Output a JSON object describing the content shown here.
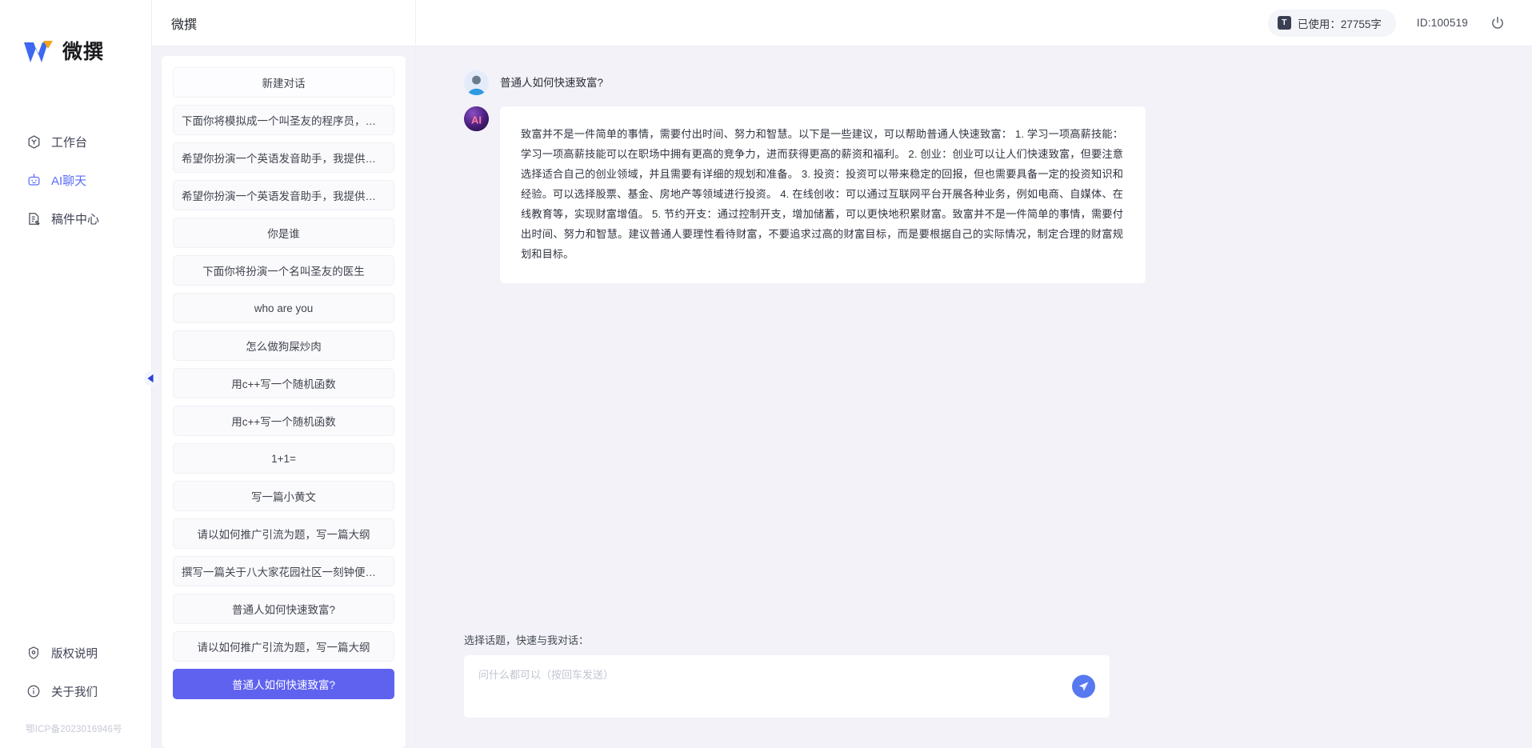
{
  "brand": {
    "logo_text": "微撰",
    "icp": "鄂ICP备2023016946号"
  },
  "nav": {
    "items": [
      {
        "label": "工作台",
        "icon": "workbench-icon",
        "active": false
      },
      {
        "label": "AI聊天",
        "icon": "robot-icon",
        "active": true
      },
      {
        "label": "稿件中心",
        "icon": "document-edit-icon",
        "active": false
      }
    ],
    "bottom_items": [
      {
        "label": "版权说明",
        "icon": "shield-icon"
      },
      {
        "label": "关于我们",
        "icon": "info-icon"
      }
    ]
  },
  "mid_header": {
    "title": "微撰"
  },
  "conversations": {
    "new_chat_label": "新建对话",
    "items": [
      {
        "label": "下面你将模拟成一个叫圣友的程序员，我说...",
        "active": false
      },
      {
        "label": "希望你扮演一个英语发音助手，我提供给你...",
        "active": false
      },
      {
        "label": "希望你扮演一个英语发音助手，我提供给你...",
        "active": false
      },
      {
        "label": "你是谁",
        "active": false
      },
      {
        "label": "下面你将扮演一个名叫圣友的医生",
        "active": false
      },
      {
        "label": "who are you",
        "active": false
      },
      {
        "label": "怎么做狗屎炒肉",
        "active": false
      },
      {
        "label": "用c++写一个随机函数",
        "active": false
      },
      {
        "label": "用c++写一个随机函数",
        "active": false
      },
      {
        "label": "1+1=",
        "active": false
      },
      {
        "label": "写一篇小黄文",
        "active": false
      },
      {
        "label": "请以如何推广引流为题，写一篇大纲",
        "active": false
      },
      {
        "label": "撰写一篇关于八大家花园社区一刻钟便民生...",
        "active": false
      },
      {
        "label": "普通人如何快速致富?",
        "active": false
      },
      {
        "label": "请以如何推广引流为题，写一篇大纲",
        "active": false
      },
      {
        "label": "普通人如何快速致富?",
        "active": true
      }
    ]
  },
  "header": {
    "usage_badge": "T",
    "usage_label": "已使用：27755字",
    "user_id": "ID:100519",
    "power_icon": "power-icon"
  },
  "chat": {
    "messages": [
      {
        "role": "user",
        "avatar": "user-avatar",
        "text": "普通人如何快速致富?"
      },
      {
        "role": "ai",
        "avatar": "ai-avatar",
        "text": "致富并不是一件简单的事情，需要付出时间、努力和智慧。以下是一些建议，可以帮助普通人快速致富： 1. 学习一项高薪技能：学习一项高薪技能可以在职场中拥有更高的竞争力，进而获得更高的薪资和福利。 2. 创业：创业可以让人们快速致富，但要注意选择适合自己的创业领域，并且需要有详细的规划和准备。 3. 投资：投资可以带来稳定的回报，但也需要具备一定的投资知识和经验。可以选择股票、基金、房地产等领域进行投资。 4. 在线创收：可以通过互联网平台开展各种业务，例如电商、自媒体、在线教育等，实现财富增值。 5. 节约开支：通过控制开支，增加储蓄，可以更快地积累财富。致富并不是一件简单的事情，需要付出时间、努力和智慧。建议普通人要理性看待财富，不要追求过高的财富目标，而是要根据自己的实际情况，制定合理的财富规划和目标。"
      }
    ]
  },
  "composer": {
    "label": "选择话题，快速与我对话：",
    "placeholder": "问什么都可以（按回车发送）",
    "value": "",
    "send_icon": "send-icon"
  },
  "colors": {
    "accent": "#5f62ef",
    "accent_send": "#5878f0",
    "page_bg": "#f2f2f8",
    "panel": "#ffffff",
    "logo_blue": "#3d68f0",
    "logo_orange": "#f6a417"
  }
}
